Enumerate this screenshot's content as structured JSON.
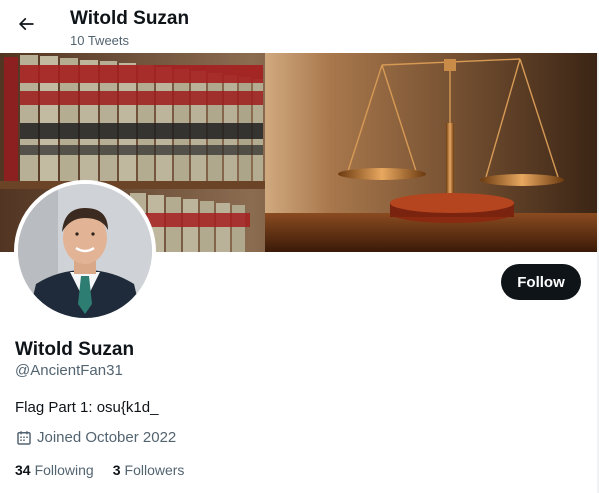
{
  "header": {
    "back_icon": "arrow-left-icon",
    "title": "Witold Suzan",
    "subtitle": "10 Tweets"
  },
  "banner": {
    "image": "law-books-and-scales-of-justice"
  },
  "profile": {
    "avatar": "man-in-suit-portrait",
    "follow_label": "Follow",
    "name": "Witold Suzan",
    "handle": "@AncientFan31",
    "bio": "Flag Part 1: osu{k1d_",
    "joined_icon": "calendar-icon",
    "joined": "Joined October 2022",
    "following_count": "34",
    "following_label": "Following",
    "followers_count": "3",
    "followers_label": "Followers"
  },
  "colors": {
    "text_primary": "#0f1419",
    "text_secondary": "#536471",
    "button_bg": "#0f1419",
    "button_text": "#ffffff"
  }
}
